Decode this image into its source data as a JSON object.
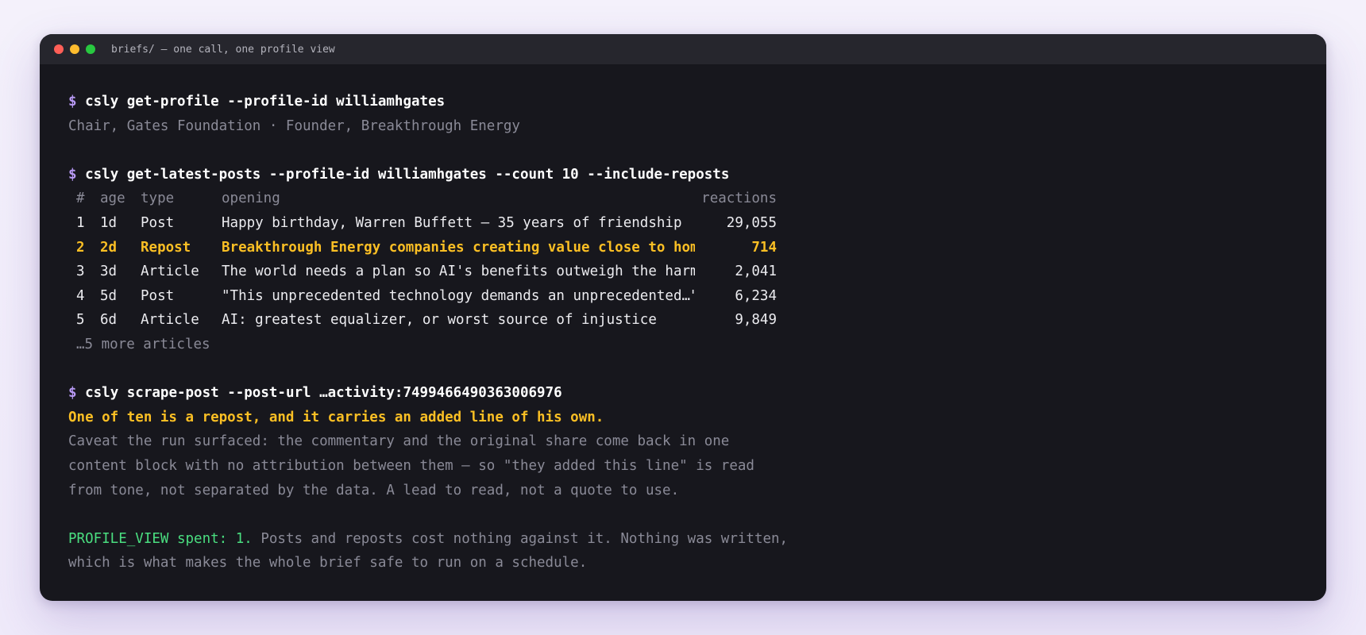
{
  "window": {
    "title": "briefs/ — one call, one profile view"
  },
  "block1": {
    "prompt": "$",
    "command": "csly get-profile --profile-id williamhgates",
    "output": "Chair, Gates Foundation · Founder, Breakthrough Energy"
  },
  "block2": {
    "prompt": "$",
    "command": "csly get-latest-posts --profile-id williamhgates --count 10 --include-reposts",
    "columns": {
      "num": "#",
      "age": "age",
      "type": "type",
      "opening": "opening",
      "reactions": "reactions"
    },
    "rows": [
      {
        "num": "1",
        "age": "1d",
        "type": "Post",
        "opening": "Happy birthday, Warren Buffett — 35 years of friendship",
        "reactions": "29,055"
      },
      {
        "num": "2",
        "age": "2d",
        "type": "Repost",
        "opening": "Breakthrough Energy companies creating value close to home",
        "reactions": "714"
      },
      {
        "num": "3",
        "age": "3d",
        "type": "Article",
        "opening": "The world needs a plan so AI's benefits outweigh the harm",
        "reactions": "2,041"
      },
      {
        "num": "4",
        "age": "5d",
        "type": "Post",
        "opening": "\"This unprecedented technology demands an unprecedented…\"",
        "reactions": "6,234"
      },
      {
        "num": "5",
        "age": "6d",
        "type": "Article",
        "opening": "AI: greatest equalizer, or worst source of injustice",
        "reactions": "9,849"
      }
    ],
    "more": "…5 more articles"
  },
  "block3": {
    "prompt": "$",
    "command": "csly scrape-post --post-url …activity:7499466490363006976",
    "finding": "One of ten is a repost, and it carries an added line of his own.",
    "caveat": [
      "Caveat the run surfaced: the commentary and the original share come back in one",
      "content block with no attribution between them — so \"they added this line\" is read",
      "from tone, not separated by the data. A lead to read, not a quote to use."
    ]
  },
  "block4": {
    "label": "PROFILE_VIEW spent: 1.",
    "text_line1": " Posts and reposts cost nothing against it. Nothing was written,",
    "text_line2": "which is what makes the whole brief safe to run on a schedule."
  },
  "colors": {
    "prompt": "#b89af5",
    "highlight": "#fbbf24",
    "success": "#4ade80",
    "muted": "#8a8a97",
    "background": "#17171d"
  }
}
